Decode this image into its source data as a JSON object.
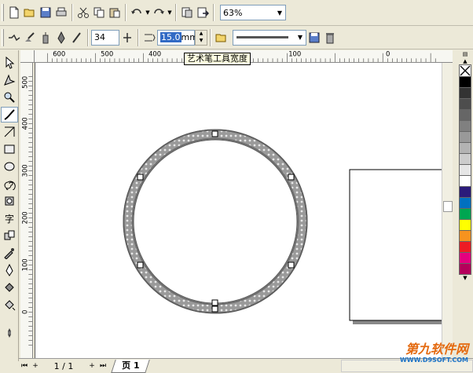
{
  "toolbar_main": {
    "zoom_value": "63%"
  },
  "property_bar": {
    "smoothing_value": "34",
    "width_value": "15.0",
    "width_unit": "mm"
  },
  "tooltip": "艺术笔工具宽度",
  "ruler_h": [
    "600",
    "500",
    "400",
    "100",
    "0"
  ],
  "ruler_v": [
    "500",
    "400",
    "300",
    "200",
    "100",
    "0"
  ],
  "page_nav": {
    "count": "1 / 1",
    "tab_label": "页 1"
  },
  "palette": [
    "#000000",
    "#333333",
    "#4d4d4d",
    "#666666",
    "#808080",
    "#999999",
    "#b3b3b3",
    "#cccccc",
    "#e6e6e6",
    "#ffffff",
    "#2b1b7a",
    "#0070c0",
    "#00a651",
    "#ffff00",
    "#f7931e",
    "#ed1c24",
    "#e4007f",
    "#b5005b"
  ],
  "watermark": {
    "line1": "第九软件网",
    "line2": "WWW.D9SOFT.COM"
  }
}
